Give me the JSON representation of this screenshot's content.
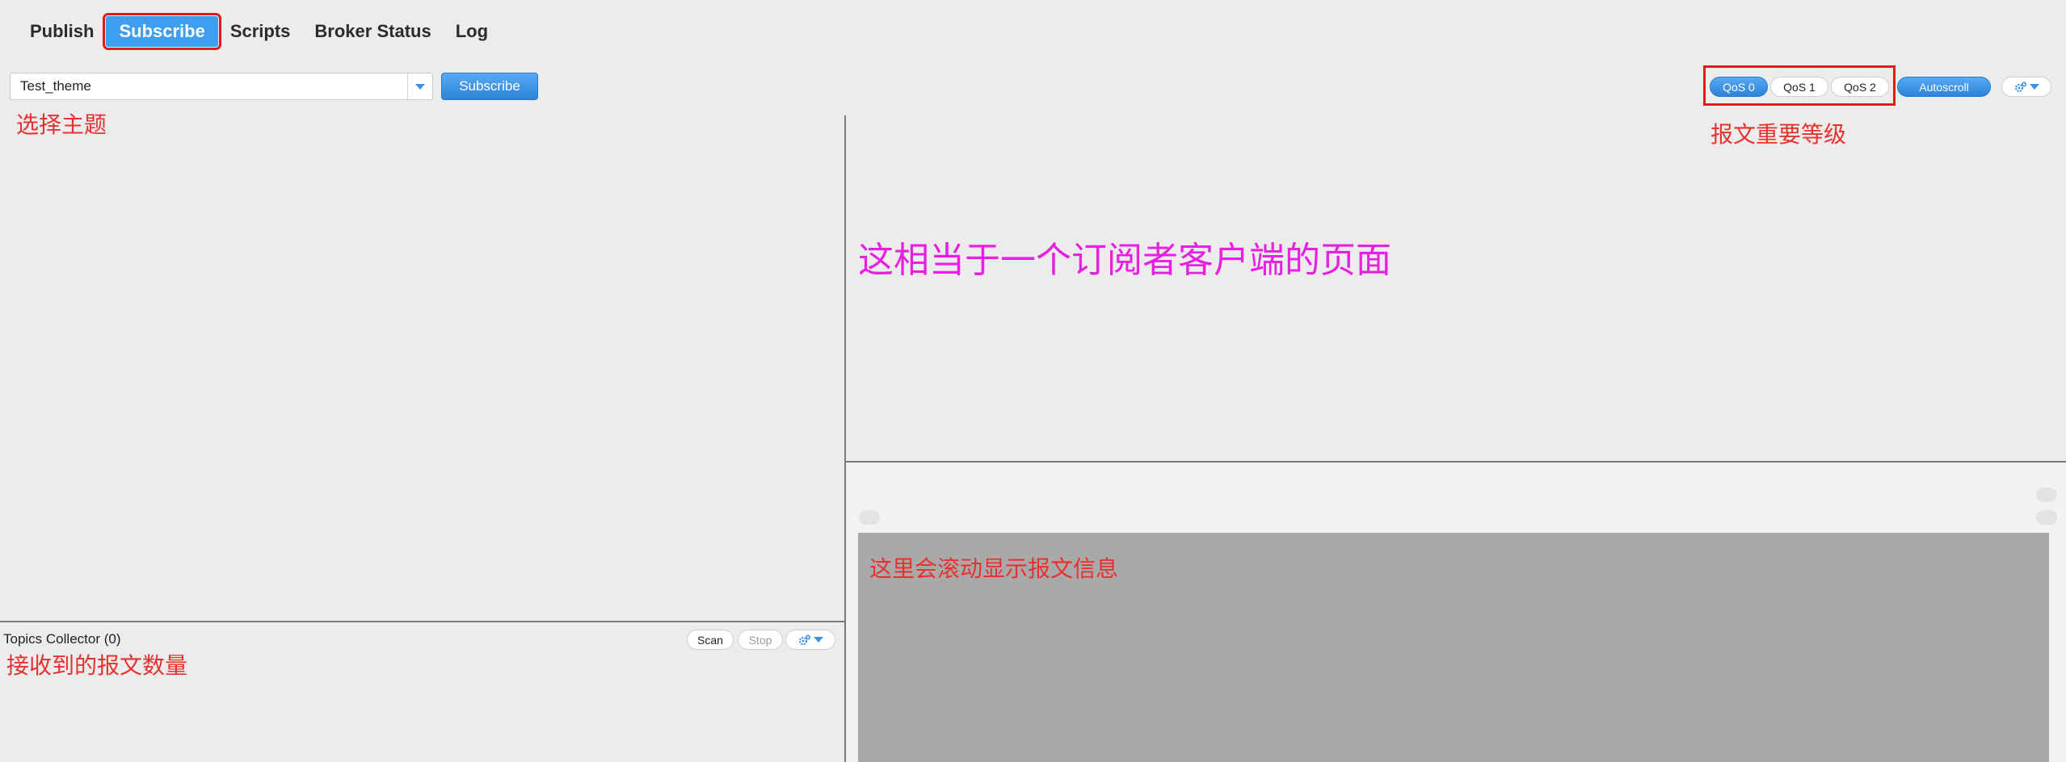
{
  "nav": {
    "tabs": [
      {
        "label": "Publish"
      },
      {
        "label": "Subscribe"
      },
      {
        "label": "Scripts"
      },
      {
        "label": "Broker Status"
      },
      {
        "label": "Log"
      }
    ],
    "active_tab": "Subscribe"
  },
  "subscribe_bar": {
    "topic_value": "Test_theme",
    "subscribe_label": "Subscribe"
  },
  "qos": {
    "options": [
      "QoS 0",
      "QoS 1",
      "QoS 2"
    ],
    "selected": "QoS 0",
    "autoscroll_label": "Autoscroll"
  },
  "topics_collector": {
    "title": "Topics Collector (0)",
    "scan_label": "Scan",
    "stop_label": "Stop"
  },
  "annotations": {
    "select_topic": "选择主题",
    "qos_level": "报文重要等级",
    "page_description": "这相当于一个订阅者客户端的页面",
    "message_scroll": "这里会滚动显示报文信息",
    "message_count": "接收到的报文数量"
  },
  "colors": {
    "accent_blue": "#3e9ef0",
    "annotation_red": "#e8312f",
    "annotation_magenta": "#e81ee3",
    "highlight_border": "#e41a1a",
    "background": "#ececec",
    "message_area": "#a9a9a9"
  },
  "icons": {
    "settings": "gear-icon",
    "dropdown": "chevron-down-icon"
  }
}
